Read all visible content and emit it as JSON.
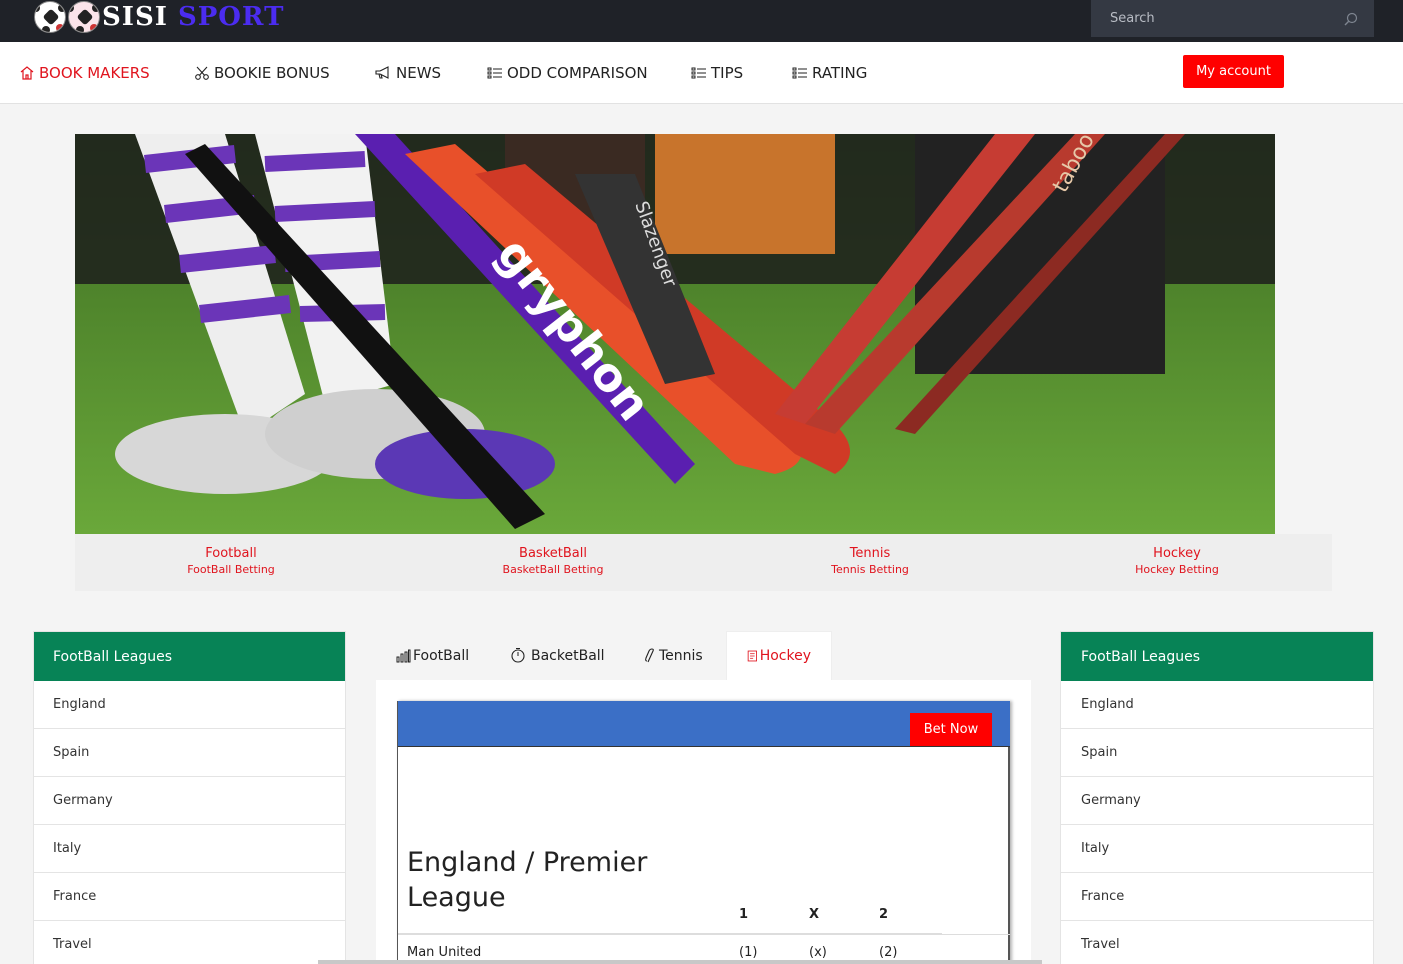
{
  "brand": {
    "part1": "SISI",
    "part2": "SPORT"
  },
  "search": {
    "placeholder": "Search"
  },
  "nav": {
    "items": [
      {
        "label": "BOOK MAKERS",
        "icon": "home-icon",
        "active": true
      },
      {
        "label": "BOOKIE BONUS",
        "icon": "scissors-icon",
        "active": false
      },
      {
        "label": "NEWS",
        "icon": "megaphone-icon",
        "active": false
      },
      {
        "label": "ODD COMPARISON",
        "icon": "list-icon",
        "active": false
      },
      {
        "label": "TIPS",
        "icon": "list-icon",
        "active": false
      },
      {
        "label": "RATING",
        "icon": "list-icon",
        "active": false
      }
    ],
    "account_label": "My account"
  },
  "sports": [
    {
      "title": "Football",
      "sub": "FootBall Betting"
    },
    {
      "title": "BasketBall",
      "sub": "BasketBall Betting"
    },
    {
      "title": "Tennis",
      "sub": "Tennis Betting"
    },
    {
      "title": "Hockey",
      "sub": "Hockey Betting"
    }
  ],
  "left_sidebar": {
    "title": "FootBall Leagues",
    "items": [
      "England",
      "Spain",
      "Germany",
      "Italy",
      "France",
      "Travel"
    ]
  },
  "right_sidebar": {
    "title": "FootBall Leagues",
    "items": [
      "England",
      "Spain",
      "Germany",
      "Italy",
      "France",
      "Travel"
    ]
  },
  "tabs": [
    {
      "label": "FootBall",
      "icon": "bar-chart-icon",
      "active": false
    },
    {
      "label": "BacketBall",
      "icon": "timer-icon",
      "active": false
    },
    {
      "label": "Tennis",
      "icon": "link-icon",
      "active": false
    },
    {
      "label": "Hockey",
      "icon": "document-icon",
      "active": true
    }
  ],
  "match_card": {
    "bet_label": "Bet Now",
    "league": "England / Premier League",
    "odds_headers": [
      "1",
      "X",
      "2"
    ],
    "rows": [
      {
        "team": "Man United",
        "odds": [
          "(1)",
          "(x)",
          "(2)"
        ]
      }
    ]
  },
  "colors": {
    "brand_red": "#ff0000",
    "accent_red": "#e0141e",
    "sidebar_green": "#078356",
    "card_blue": "#3b6fc6",
    "topbar": "#1f2228"
  }
}
